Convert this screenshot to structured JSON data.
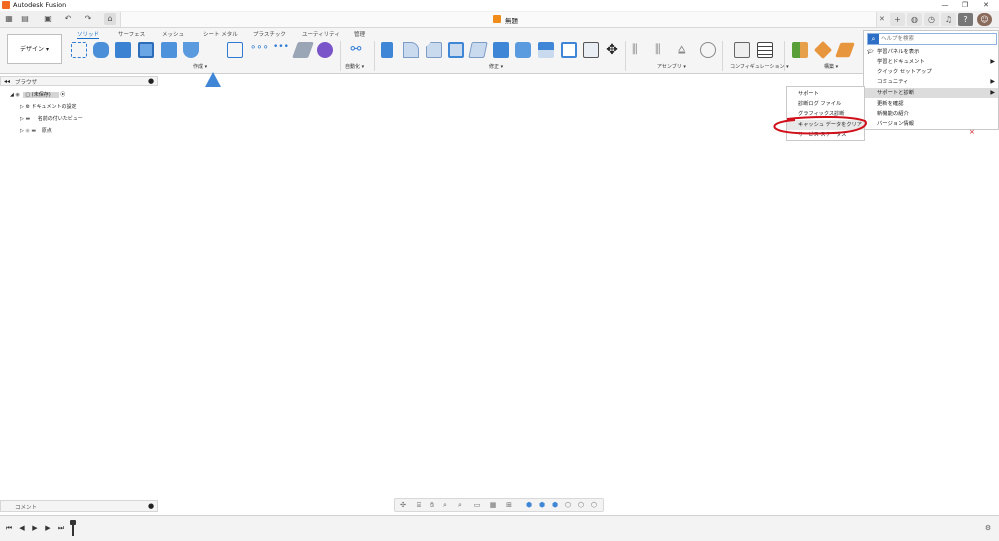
{
  "titlebar": {
    "title": "Autodesk Fusion",
    "minimize": "—",
    "restore": "❐",
    "close": "✕"
  },
  "doc": {
    "name": "無題",
    "close": "✕",
    "new_tab": "+"
  },
  "ribbon": {
    "workspace": "デザイン ▾",
    "tabs": [
      "ソリッド",
      "サーフェス",
      "メッシュ",
      "シート メタル",
      "プラスチック",
      "ユーティリティ",
      "管理"
    ],
    "groups": [
      "作成 ▾",
      "自動化 ▾",
      "修正 ▾",
      "アセンブリ ▾",
      "コンフィギュレーション ▾",
      "構築 ▾"
    ]
  },
  "browser": {
    "title": "ブラウザ",
    "root": "(未保存)",
    "items": [
      "ドキュメントの設定",
      "名前の付いたビュー",
      "原点"
    ]
  },
  "help_menu": {
    "search_placeholder": "ヘルプを検索",
    "items": [
      "学習パネルを表示",
      "学習とドキュメント",
      "クイック セットアップ",
      "コミュニティ",
      "サポートと診断",
      "更新を確認",
      "新機能の紹介",
      "バージョン情報"
    ]
  },
  "support_submenu": {
    "items": [
      "サポート",
      "診断ログ ファイル",
      "グラフィックス診断",
      "キャッシュ データをクリア",
      "サービス ステータス"
    ]
  },
  "comment": {
    "title": "コメント"
  },
  "colors": {
    "accent": "#1a6fc9",
    "annotation": "#d0101a",
    "orange": "#f08c1a"
  }
}
